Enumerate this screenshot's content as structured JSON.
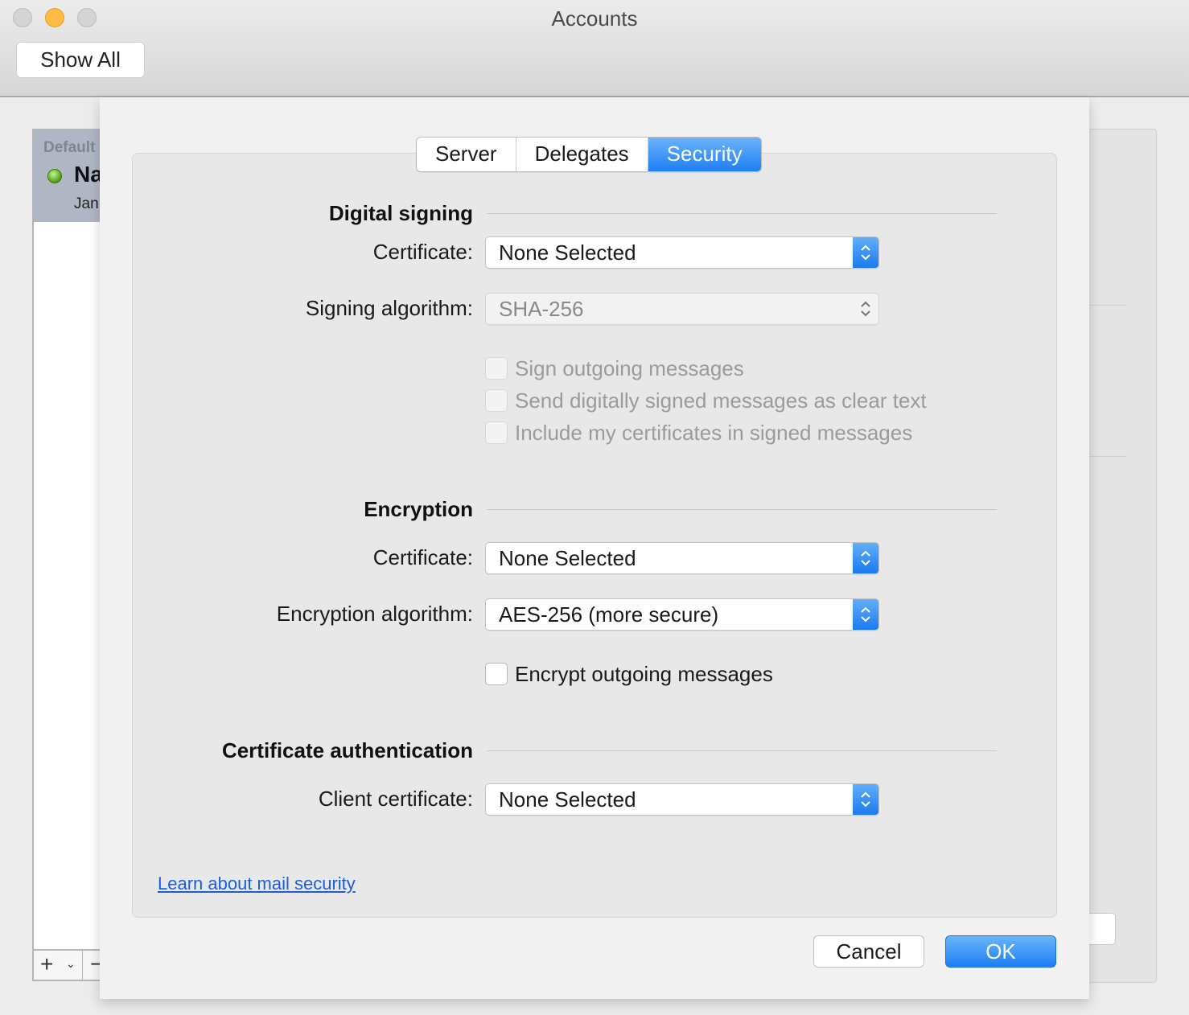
{
  "window": {
    "title": "Accounts",
    "show_all_label": "Show All"
  },
  "account_list": {
    "default_label": "Default",
    "account_name": "Na",
    "account_email": "Jan",
    "add_label": "+",
    "chevron": "⌄",
    "remove_label": "−"
  },
  "tabs": [
    {
      "label": "Server"
    },
    {
      "label": "Delegates"
    },
    {
      "label": "Security",
      "active": true
    }
  ],
  "digital_signing": {
    "title": "Digital signing",
    "certificate_label": "Certificate:",
    "certificate_value": "None Selected",
    "algorithm_label": "Signing algorithm:",
    "algorithm_value": "SHA-256",
    "options": [
      {
        "label": "Sign outgoing messages",
        "checked": false,
        "enabled": false
      },
      {
        "label": "Send digitally signed messages as clear text",
        "checked": false,
        "enabled": false
      },
      {
        "label": "Include my certificates in signed messages",
        "checked": false,
        "enabled": false
      }
    ]
  },
  "encryption": {
    "title": "Encryption",
    "certificate_label": "Certificate:",
    "certificate_value": "None Selected",
    "algorithm_label": "Encryption algorithm:",
    "algorithm_value": "AES-256 (more secure)",
    "encrypt_label": "Encrypt outgoing messages",
    "encrypt_checked": false
  },
  "certificate_authentication": {
    "title": "Certificate authentication",
    "client_label": "Client certificate:",
    "client_value": "None Selected"
  },
  "footer": {
    "learn_link": "Learn about mail security",
    "cancel_label": "Cancel",
    "ok_label": "OK"
  },
  "colors": {
    "accent": "#1d7ff3",
    "link": "#1a5ee0",
    "status_online": "#4c9c1a"
  }
}
